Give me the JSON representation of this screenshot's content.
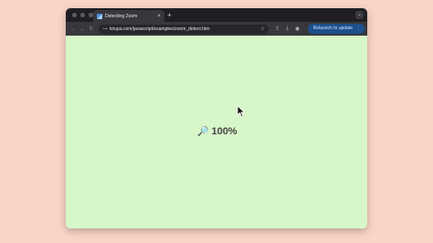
{
  "tab": {
    "title": "Detecting Zoom",
    "close_glyph": "×"
  },
  "newtab": {
    "glyph": "+"
  },
  "tabmenu": {
    "glyph": "⌄"
  },
  "nav": {
    "back": "←",
    "forward": "→",
    "reload": "↻"
  },
  "omnibox": {
    "site_icon": "⊶",
    "url": "kirupa.com/javascript/examples/zoom_detect.htm",
    "star": "☆"
  },
  "toolbar_icons": {
    "share": "⇪",
    "download": "⤓",
    "profile": "◉"
  },
  "relaunch": {
    "label": "Relaunch to update",
    "dots": "⋮"
  },
  "page": {
    "magnifier_icon": "🔎",
    "zoom_value": "100%"
  }
}
